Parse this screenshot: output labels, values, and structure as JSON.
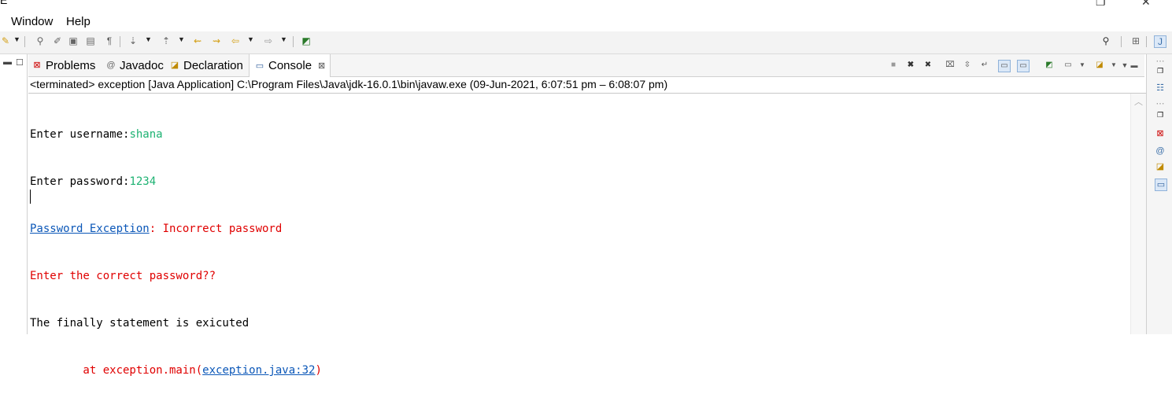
{
  "window": {
    "title_fragment": "E",
    "restore_glyph": "❐",
    "close_glyph": "✕"
  },
  "menu": {
    "items": [
      "Window",
      "Help"
    ]
  },
  "tabs": [
    {
      "label": "Problems",
      "icon": "problems-icon"
    },
    {
      "label": "Javadoc",
      "icon": "javadoc-icon"
    },
    {
      "label": "Declaration",
      "icon": "declaration-icon"
    },
    {
      "label": "Console",
      "icon": "console-icon",
      "active": true,
      "close": "⊠"
    }
  ],
  "console": {
    "status": "<terminated> exception [Java Application] C:\\Program Files\\Java\\jdk-16.0.1\\bin\\javaw.exe  (09-Jun-2021, 6:07:51 pm – 6:08:07 pm)",
    "lines": {
      "l1_prompt": "Enter username:",
      "l1_input": "shana",
      "l2_prompt": "Enter password:",
      "l2_input": "1234",
      "l3_link": "Password Exception",
      "l3_rest": ": Incorrect password",
      "l4": "Enter the correct password??",
      "l5": "The finally statement is exicuted",
      "l6_pre": "        at exception.main(",
      "l6_link": "exception.java:32",
      "l6_post": ")"
    }
  },
  "colors": {
    "input": "#1db272",
    "error": "#e00000",
    "link": "#0b57b8"
  }
}
